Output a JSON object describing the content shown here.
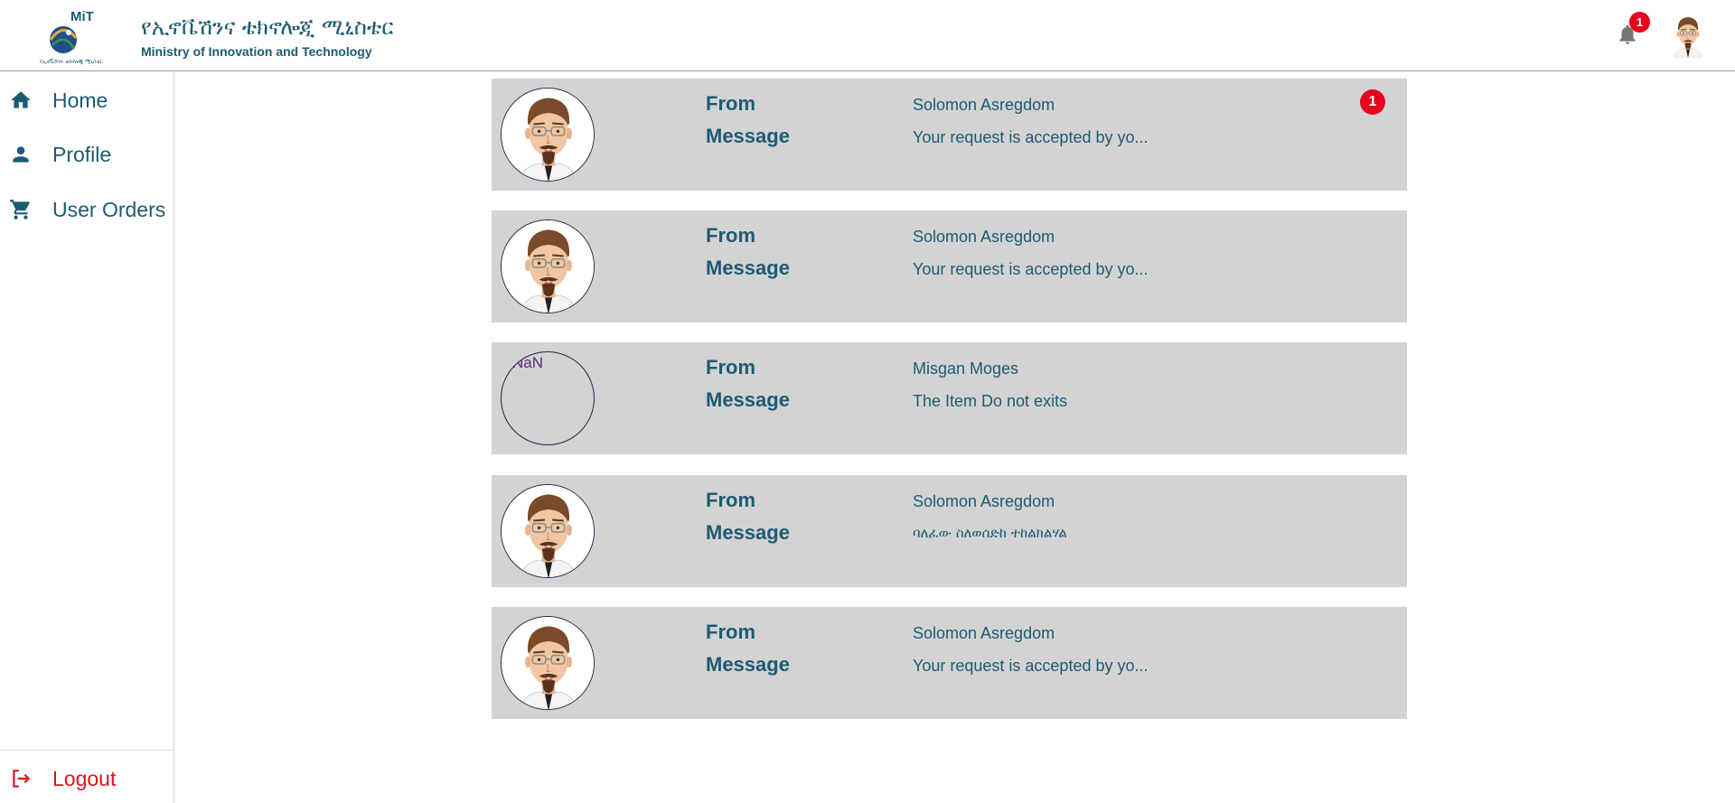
{
  "header": {
    "brand_amharic": "የኢኖቬሽንና ቴክኖሎጂ ሚኒስቴር",
    "brand_english": "Ministry of Innovation and Technology",
    "logo_text": "MiT",
    "logo_sub": "የኢኖቬሽንና ቴክኖሎጂ ሚኒስቴር",
    "notification_count": "1"
  },
  "sidebar": {
    "items": [
      {
        "label": "Home",
        "icon": "home-icon"
      },
      {
        "label": "Profile",
        "icon": "person-icon"
      },
      {
        "label": "User Orders",
        "icon": "cart-icon"
      }
    ],
    "logout_label": "Logout"
  },
  "labels": {
    "from": "From",
    "message": "Message"
  },
  "messages": [
    {
      "from": "Solomon Asregdom",
      "message": "Your request is accepted by yo...",
      "avatar": "man-avatar",
      "badge": "1"
    },
    {
      "from": "Solomon Asregdom",
      "message": "Your request is accepted by yo...",
      "avatar": "man-avatar"
    },
    {
      "from": "Misgan Moges",
      "message": "The Item Do not exits",
      "avatar_text": "NaN"
    },
    {
      "from": "Solomon Asregdom",
      "message": "ባለፈው ስለወሰድከ ተከልክልሃል",
      "avatar": "man-avatar"
    },
    {
      "from": "Solomon Asregdom",
      "message": "Your request is accepted by yo...",
      "avatar": "man-avatar"
    }
  ],
  "colors": {
    "primary_text": "#1d5a72",
    "card_bg": "#d3d3d3",
    "badge": "#e8001c",
    "logout": "#e01020"
  }
}
